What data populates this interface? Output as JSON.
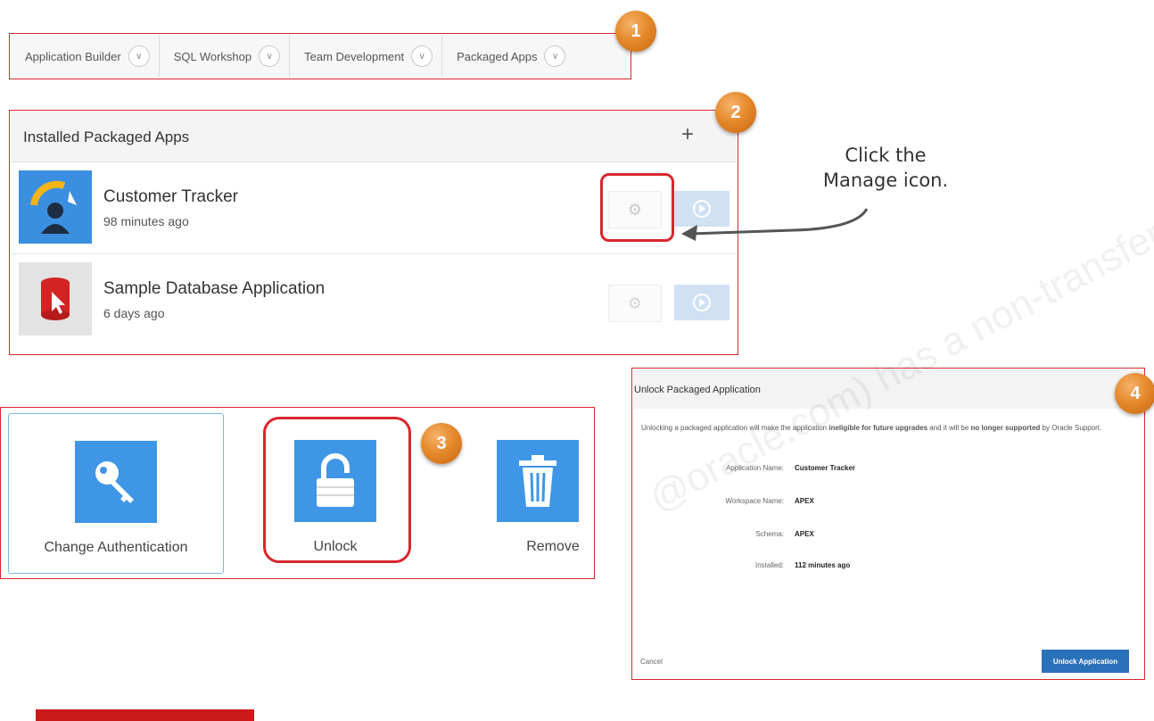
{
  "nav": {
    "tabs": [
      {
        "label": "Application Builder"
      },
      {
        "label": "SQL Workshop"
      },
      {
        "label": "Team Development"
      },
      {
        "label": "Packaged Apps"
      }
    ]
  },
  "steps": {
    "one": "1",
    "two": "2",
    "three": "3",
    "four": "4"
  },
  "installed": {
    "title": "Installed Packaged Apps",
    "apps": [
      {
        "name": "Customer Tracker",
        "time": "98 minutes ago"
      },
      {
        "name": "Sample Database Application",
        "time": "6 days ago"
      }
    ]
  },
  "callout": {
    "line1": "Click the",
    "line2": "Manage icon."
  },
  "actions": {
    "change_auth": "Change Authentication",
    "unlock": "Unlock",
    "remove": "Remove"
  },
  "dialog": {
    "title": "Unlock Packaged Application",
    "text_part1": "Unlocking a packaged application will make the application ",
    "text_bold1": "ineligible for future upgrades",
    "text_part2": " and it will be ",
    "text_bold2": "no longer supported",
    "text_part3": " by Oracle Support.",
    "fields": [
      {
        "key": "Application Name:",
        "value": "Customer Tracker"
      },
      {
        "key": "Workspace Name:",
        "value": "APEX"
      },
      {
        "key": "Schema:",
        "value": "APEX"
      },
      {
        "key": "Installed:",
        "value": "112 minutes ago"
      }
    ],
    "cancel": "Cancel",
    "unlock_button": "Unlock Application"
  },
  "watermark": "@oracle.com) has a non-transferable license to use this Student Guide.",
  "colors": {
    "frame": "#d9262e",
    "badge": "#e58a2c",
    "accent_blue": "#3f96e6",
    "button_blue": "#2b71b9"
  }
}
